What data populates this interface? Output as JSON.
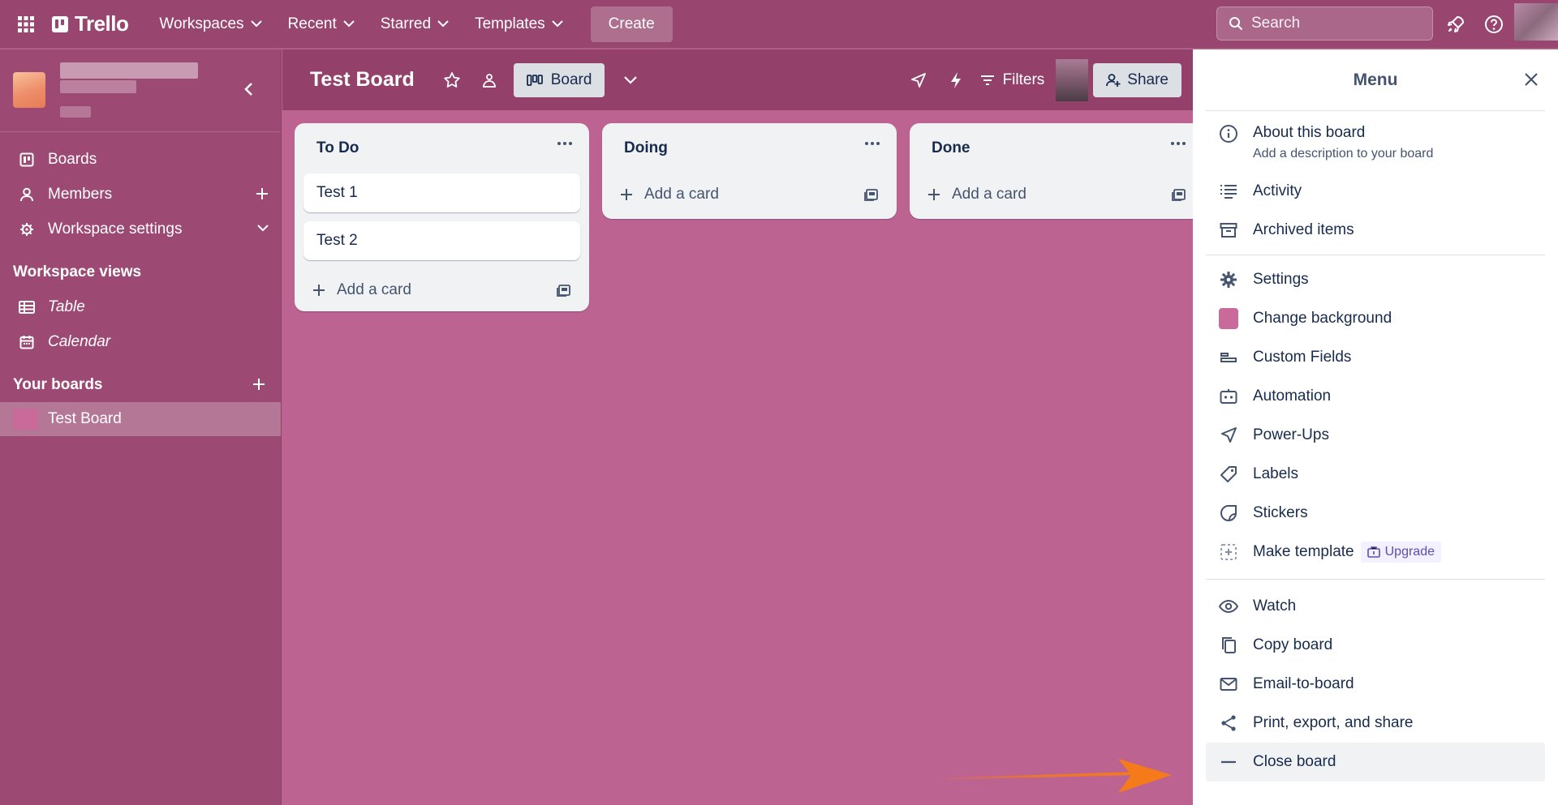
{
  "topnav": {
    "logo_text": "Trello",
    "items": [
      {
        "label": "Workspaces"
      },
      {
        "label": "Recent"
      },
      {
        "label": "Starred"
      },
      {
        "label": "Templates"
      }
    ],
    "create_label": "Create",
    "search_placeholder": "Search"
  },
  "sidebar": {
    "nav": [
      {
        "label": "Boards",
        "icon": "board-icon"
      },
      {
        "label": "Members",
        "icon": "person-icon"
      },
      {
        "label": "Workspace settings",
        "icon": "gear-icon"
      }
    ],
    "views_title": "Workspace views",
    "views": [
      {
        "label": "Table",
        "icon": "table-icon"
      },
      {
        "label": "Calendar",
        "icon": "calendar-icon"
      }
    ],
    "boards_title": "Your boards",
    "boards": [
      {
        "label": "Test Board",
        "color": "#c96a9a"
      }
    ]
  },
  "board": {
    "title": "Test Board",
    "view_label": "Board",
    "filters_label": "Filters",
    "share_label": "Share"
  },
  "lists": [
    {
      "title": "To Do",
      "cards": [
        "Test 1",
        "Test 2"
      ],
      "add_label": "Add a card"
    },
    {
      "title": "Doing",
      "cards": [],
      "add_label": "Add a card"
    },
    {
      "title": "Done",
      "cards": [],
      "add_label": "Add a card"
    }
  ],
  "menu": {
    "title": "Menu",
    "about": {
      "label": "About this board",
      "sub": "Add a description to your board"
    },
    "group1": [
      {
        "label": "Activity",
        "icon": "activity-icon"
      },
      {
        "label": "Archived items",
        "icon": "archive-icon"
      }
    ],
    "group2": [
      {
        "label": "Settings",
        "icon": "gear-icon"
      },
      {
        "label": "Change background",
        "icon": "swatch"
      },
      {
        "label": "Custom Fields",
        "icon": "custom-fields-icon"
      },
      {
        "label": "Automation",
        "icon": "automation-icon"
      },
      {
        "label": "Power-Ups",
        "icon": "rocket-icon"
      },
      {
        "label": "Labels",
        "icon": "label-icon"
      },
      {
        "label": "Stickers",
        "icon": "sticker-icon"
      }
    ],
    "make_template": {
      "label": "Make template",
      "badge": "Upgrade"
    },
    "group3": [
      {
        "label": "Watch",
        "icon": "eye-icon"
      },
      {
        "label": "Copy board",
        "icon": "copy-icon"
      },
      {
        "label": "Email-to-board",
        "icon": "mail-icon"
      },
      {
        "label": "Print, export, and share",
        "icon": "share-icon"
      }
    ],
    "close_board": {
      "label": "Close board"
    }
  },
  "colors": {
    "accent_arrow": "#f57a1a",
    "board_background": "#bc6392",
    "nav_background": "#98466f"
  }
}
